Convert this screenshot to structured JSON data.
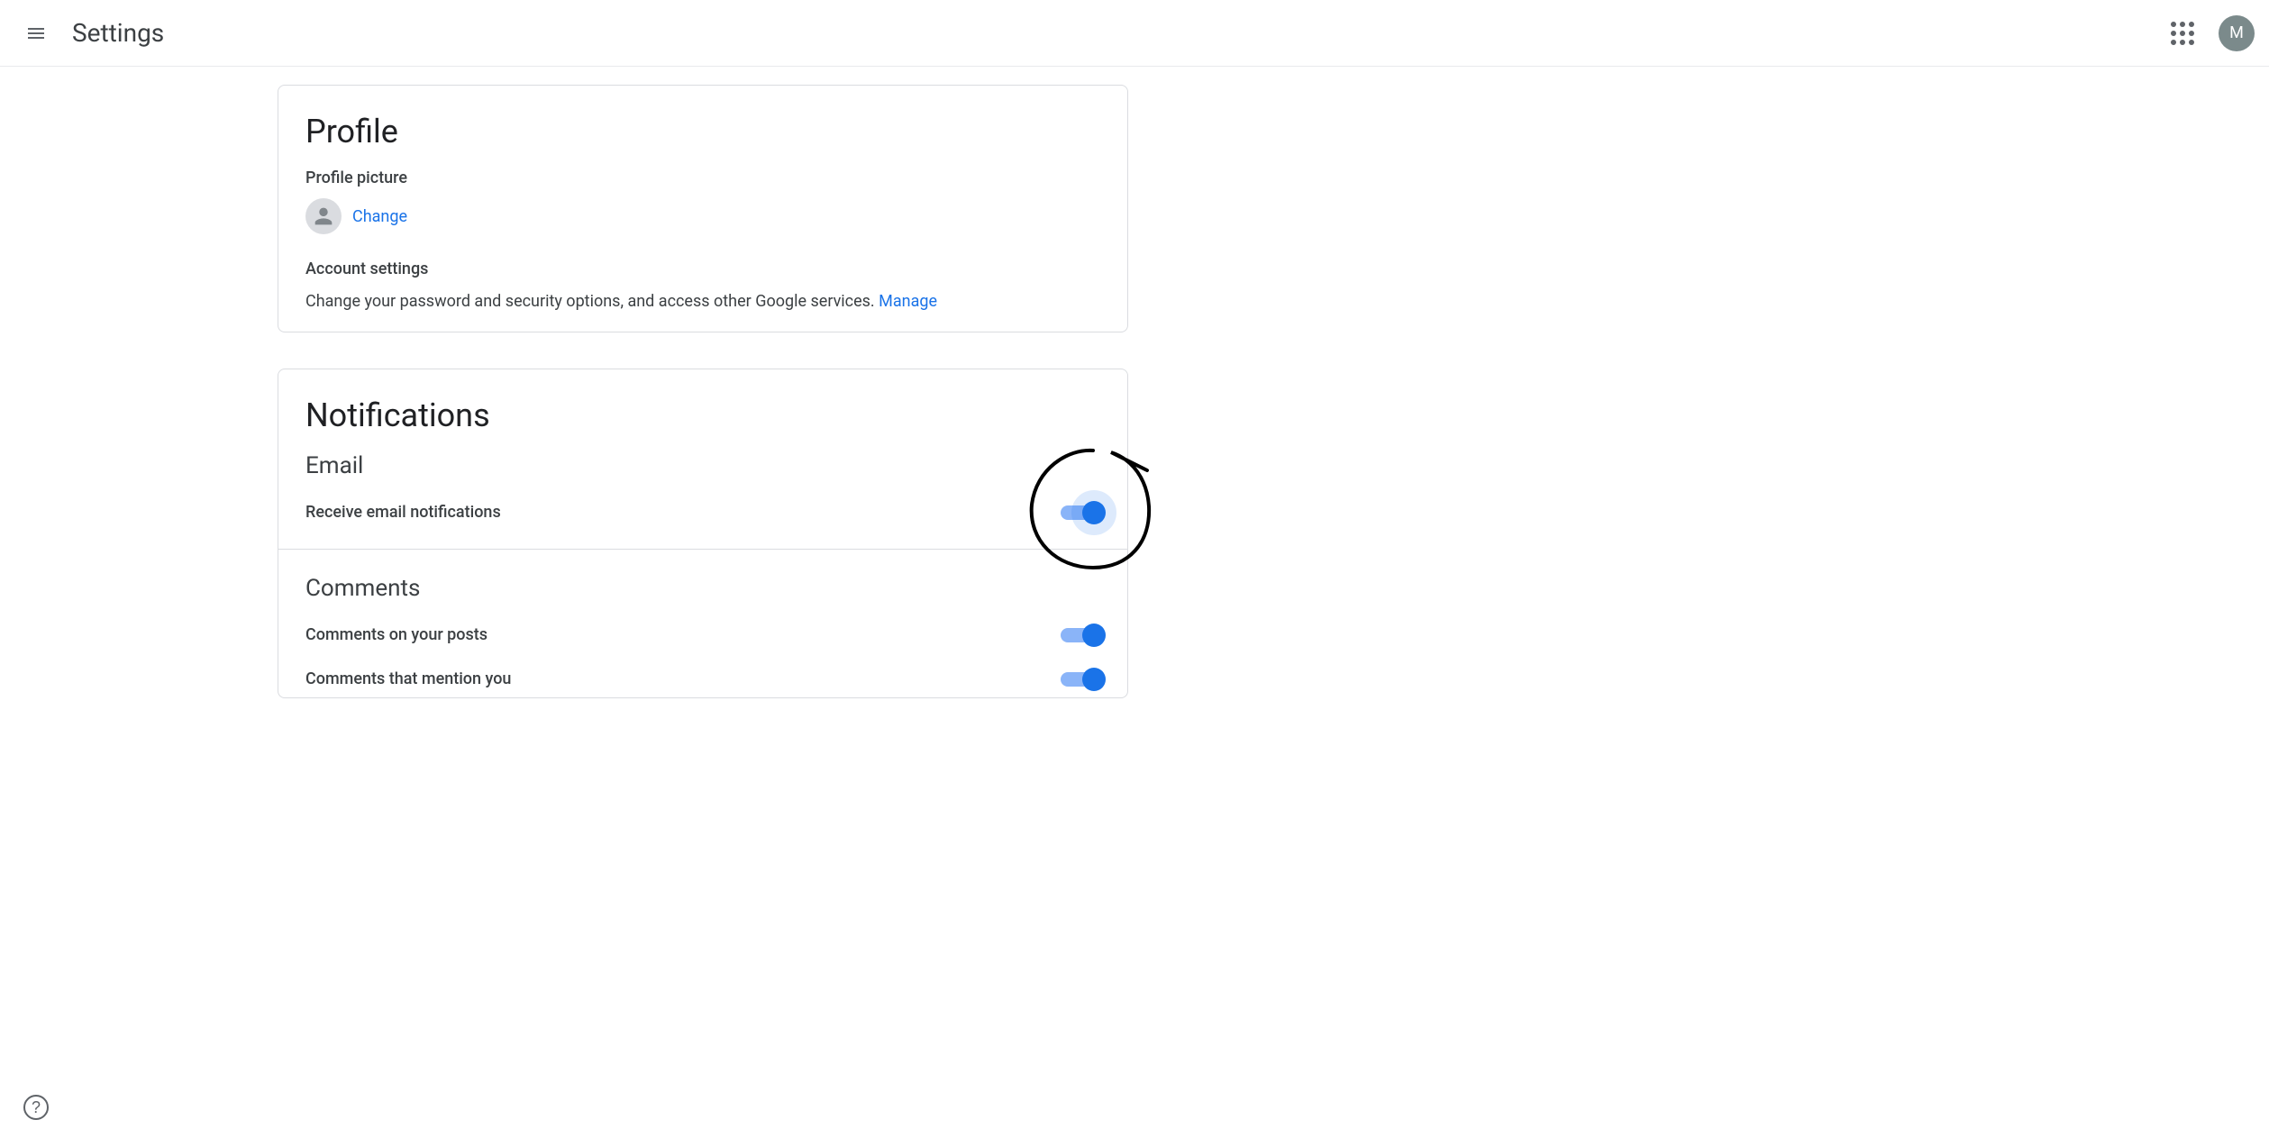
{
  "header": {
    "title": "Settings",
    "avatar_initial": "M"
  },
  "profile": {
    "title": "Profile",
    "picture_label": "Profile picture",
    "change_link": "Change",
    "account_label": "Account settings",
    "account_desc": "Change your password and security options, and access other Google services. ",
    "manage_link": "Manage"
  },
  "notifications": {
    "title": "Notifications",
    "email": {
      "heading": "Email",
      "receive_label": "Receive email notifications"
    },
    "comments": {
      "heading": "Comments",
      "on_posts_label": "Comments on your posts",
      "mention_label": "Comments that mention you"
    }
  }
}
